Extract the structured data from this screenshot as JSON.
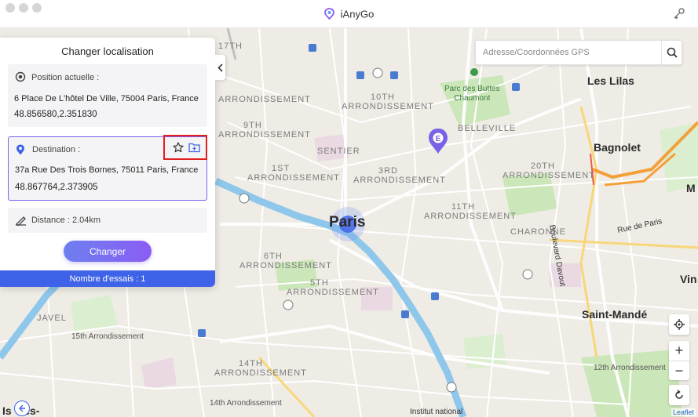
{
  "window": {
    "title": "iAnyGo"
  },
  "search": {
    "placeholder": "Adresse/Coordonnées GPS"
  },
  "panel": {
    "title": "Changer localisation",
    "current": {
      "label": "Position actuelle :",
      "address": "6 Place De L'hôtel De Ville, 75004 Paris, France",
      "coords": "48.856580,2.351830"
    },
    "destination": {
      "label": "Destination :",
      "address": "37a Rue Des Trois Bornes, 75011 Paris, France",
      "coords": "48.867764,2.373905"
    },
    "distance": "Distance : 2.04km",
    "change_button": "Changer",
    "attempts": "Nombre d'essais : 1"
  },
  "map": {
    "labels": {
      "l17": "17TH",
      "l10a": "10TH",
      "l10b": "ARRONDISSEMENT",
      "l8": "ARRONDISSEMENT",
      "l9": "9TH",
      "l9b": "ARRONDISSEMENT",
      "sentier": "SENTIER",
      "belleville": "BELLEVILLE",
      "l1a": "1ST",
      "l1b": "ARRONDISSEMENT",
      "l3a": "3RD",
      "l3b": "ARRONDISSEMENT",
      "l20a": "20TH",
      "l20b": "ARRONDISSEMENT",
      "l11a": "11TH",
      "l11b": "ARRONDISSEMENT",
      "charonne": "CHARONNE",
      "l6a": "6TH",
      "l6b": "ARRONDISSEMENT",
      "l5a": "5TH",
      "l5b": "ARRONDISSEMENT",
      "javel": "JAVEL",
      "l15": "15th Arrondissement",
      "l14a": "14TH",
      "l14b": "ARRONDISSEMENT",
      "l14c": "14th Arrondissement",
      "l12": "12th Arrondissement",
      "paris": "Paris",
      "les_lilas": "Les Lilas",
      "bagnolet": "Bagnolet",
      "montreuil": "M",
      "vincennes": "Vin",
      "saint_mande": "Saint-Mandé",
      "issy": "Is   les-",
      "park": "Parc des Buttes\nChaumont",
      "rue_de_paris": "Rue de Paris",
      "bd_davout": "Boulevard Davout",
      "institut": "Institut national"
    },
    "attribution": "Leaflet"
  },
  "colors": {
    "accent": "#3f63e8",
    "gradient_start": "#6d7ff0",
    "gradient_end": "#8b5df3",
    "highlight": "#e02020",
    "river": "#8fc7ea",
    "park": "#c9e6b8",
    "route_orange": "#f4a03a"
  },
  "icons": {
    "logo": "ianygo-logo-icon",
    "key": "key-icon",
    "search": "search-icon",
    "target": "target-icon",
    "pin": "location-pin-icon",
    "star": "star-icon",
    "folder": "folder-icon",
    "distance": "ruler-icon",
    "locate": "locate-icon",
    "reset": "reset-icon"
  }
}
